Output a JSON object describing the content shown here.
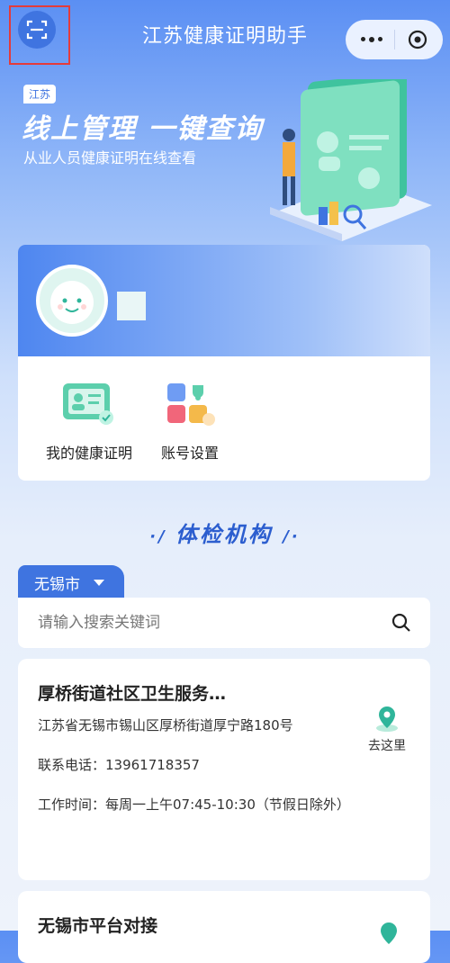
{
  "header": {
    "title": "江苏健康证明助手",
    "scan_icon": "scan-icon",
    "more_icon": "more-dots-icon",
    "close_icon": "target-icon"
  },
  "banner": {
    "tag": "江苏",
    "slogan": "线上管理 一键查询",
    "subtitle": "从业人员健康证明在线查看"
  },
  "profile": {
    "avatar_icon": "smiley-avatar-icon",
    "actions": [
      {
        "label": "我的健康证明",
        "icon": "health-card-icon"
      },
      {
        "label": "账号设置",
        "icon": "settings-blocks-icon"
      }
    ]
  },
  "section": {
    "title": "体检机构"
  },
  "filter": {
    "city": "无锡市",
    "search_placeholder": "请输入搜索关键词"
  },
  "institutions": [
    {
      "name": "厚桥街道社区卫生服务…",
      "address": "江苏省无锡市锡山区厚桥街道厚宁路180号",
      "phone": "联系电话：13961718357",
      "hours": "工作时间：每周一上午07:45-10:30（节假日除外）",
      "goto_label": "去这里"
    },
    {
      "name": "无锡市平台对接"
    }
  ],
  "colors": {
    "accent": "#3f74e0",
    "teal": "#2fb59a"
  }
}
